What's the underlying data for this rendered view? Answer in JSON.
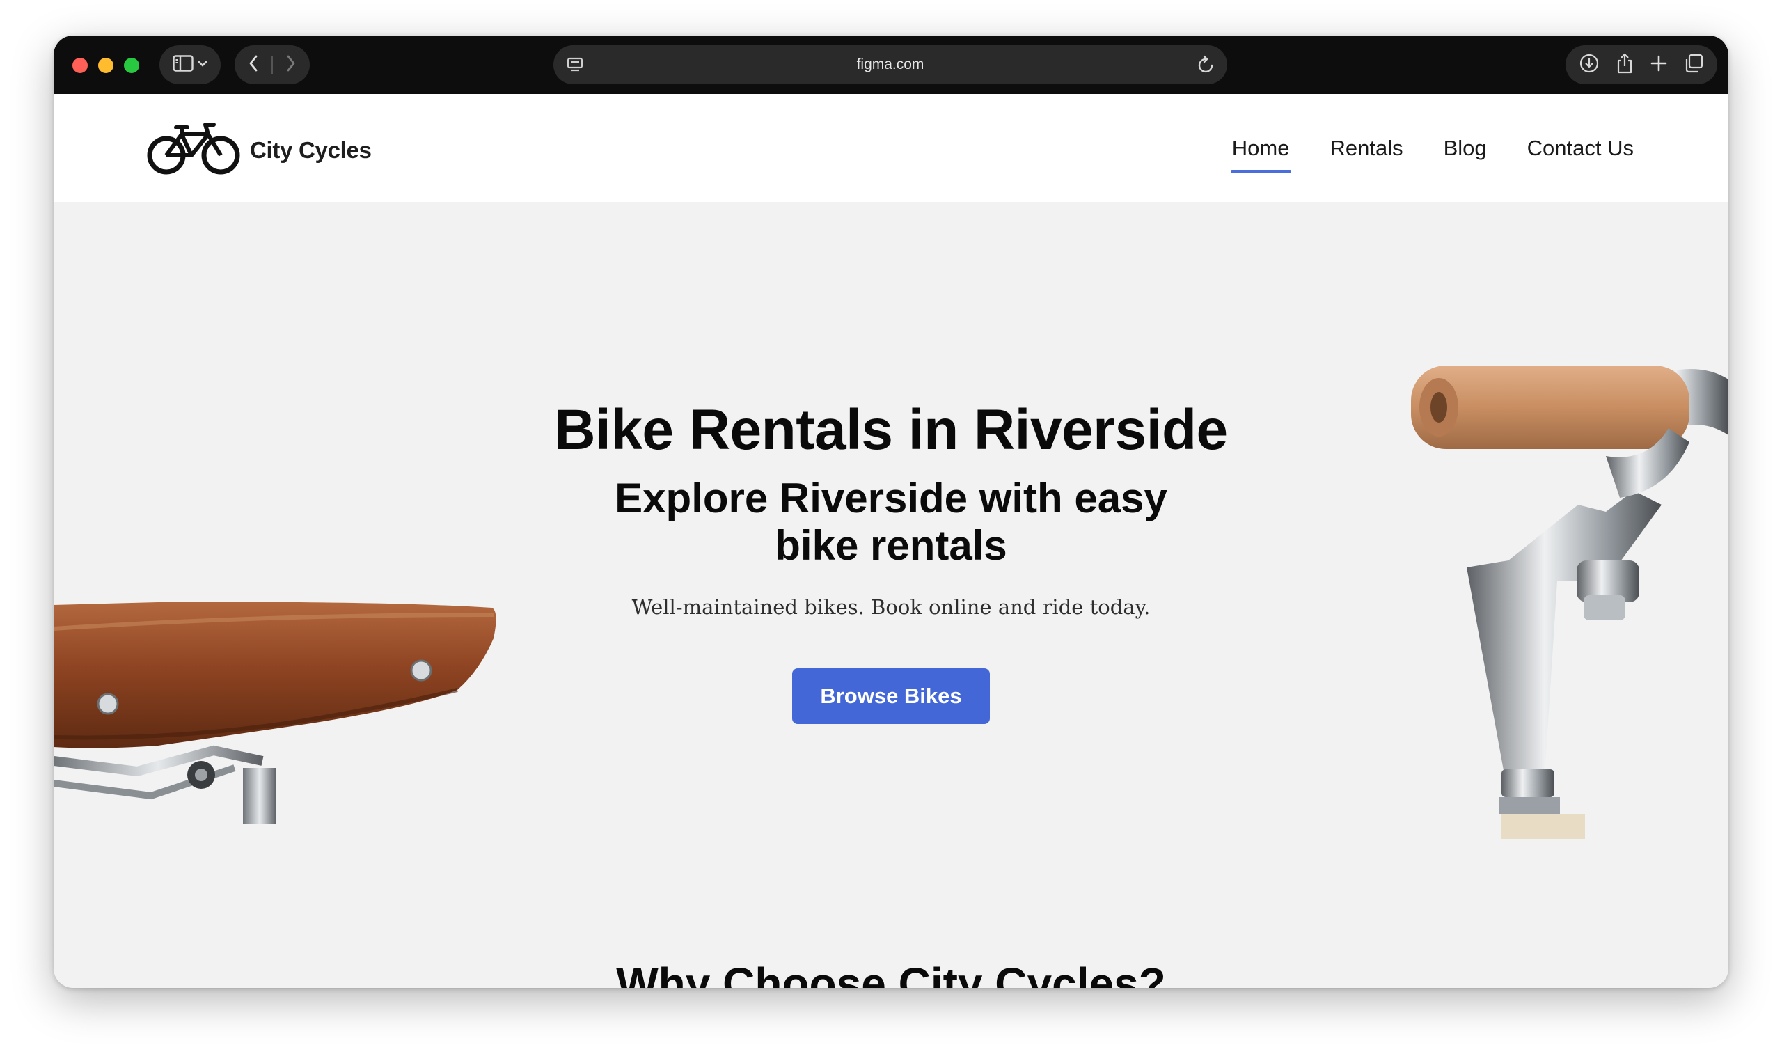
{
  "browser": {
    "url": "figma.com"
  },
  "site": {
    "brand": "City Cycles",
    "nav": [
      {
        "label": "Home",
        "active": true
      },
      {
        "label": "Rentals",
        "active": false
      },
      {
        "label": "Blog",
        "active": false
      },
      {
        "label": "Contact Us",
        "active": false
      }
    ]
  },
  "hero": {
    "title": "Bike Rentals in Riverside",
    "subtitle_line1": "Explore Riverside with easy",
    "subtitle_line2": "bike rentals",
    "description": "Well-maintained bikes. Book online and ride today.",
    "cta_label": "Browse Bikes"
  },
  "section": {
    "why_title": "Why Choose City Cycles?"
  },
  "colors": {
    "accent": "#4467d8",
    "nav_underline": "#4a6fdc",
    "hero_bg": "#f2f2f2"
  }
}
